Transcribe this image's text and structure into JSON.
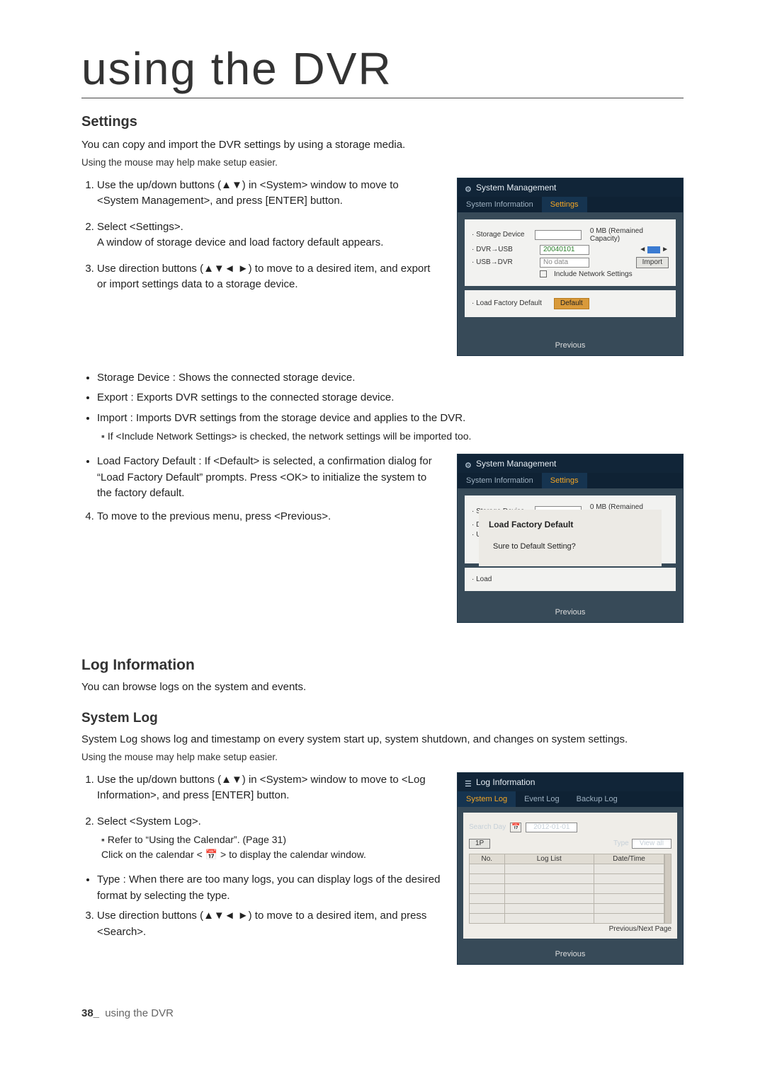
{
  "page": {
    "chapter_title": "using the DVR",
    "footer_num": "38_",
    "footer_text": "using the DVR"
  },
  "settings": {
    "heading": "Settings",
    "intro": "You can copy and import the DVR settings by using a storage media.",
    "mouse_hint": "Using the mouse may help make setup easier.",
    "steps": {
      "s1": "Use the up/down buttons (▲▼) in <System> window to move to <System Management>, and press [ENTER] button.",
      "s2a": "Select <Settings>.",
      "s2b": "A window of storage device and load factory default appears.",
      "s3": "Use direction buttons (▲▼◄ ►) to move to a desired item, and export or import settings data to a storage device."
    },
    "bullets": {
      "b1": "Storage Device : Shows the connected storage device.",
      "b2": "Export : Exports DVR settings to the connected storage device.",
      "b3": "Import : Imports DVR settings from the storage device and applies to the DVR.",
      "b3a": "If <Include Network Settings> is checked, the network settings will be imported too.",
      "b4": "Load Factory Default : If <Default> is selected, a confirmation dialog for “Load Factory Default” prompts. Press <OK> to initialize the system to the factory default."
    },
    "step4": "To move to the previous menu, press <Previous>."
  },
  "dvr1": {
    "title": "System Management",
    "tabs": {
      "info": "System Information",
      "settings": "Settings"
    },
    "storage_label": "· Storage Device",
    "capacity_text": "0 MB (Remained Capacity)",
    "dvr_usb_label": "· DVR→USB",
    "dvr_usb_value": "20040101",
    "usb_dvr_label": "· USB→DVR",
    "usb_dvr_value": "No data",
    "import_btn": "Import",
    "include_net": "Include Network Settings",
    "lfd_label": "· Load Factory Default",
    "default_btn": "Default",
    "previous": "Previous"
  },
  "dvr2": {
    "title": "System Management",
    "tabs": {
      "info": "System Information",
      "settings": "Settings"
    },
    "storage_label": "· Storage Device",
    "capacity_text": "0 MB (Remained Capacity)",
    "dvr_stub": "· DVR",
    "usb_stub": "· USB",
    "load_stub": "· Load",
    "modal_title": "Load Factory Default",
    "modal_msg": "Sure to Default Setting?",
    "previous": "Previous"
  },
  "loginfo": {
    "heading": "Log Information",
    "intro": "You can browse logs on the system and events."
  },
  "syslog": {
    "heading": "System Log",
    "intro": "System Log shows log and timestamp on every system start up, system shutdown, and changes on system settings.",
    "mouse_hint": "Using the mouse may help make setup easier.",
    "steps": {
      "s1": "Use the up/down buttons (▲▼) in <System> window to move to <Log Information>, and press [ENTER] button.",
      "s2a": "Select <System Log>.",
      "s2b": "Refer to “Using the Calendar”. (Page 31)",
      "s2c": "Click on the calendar < 📅 > to display the calendar window."
    },
    "bullets": {
      "b1": "Type : When there are too many logs, you can display logs of the desired format by selecting the type."
    },
    "step3": "Use direction buttons (▲▼◄ ►) to move to a desired item, and press <Search>."
  },
  "dvr3": {
    "title": "Log Information",
    "tabs": {
      "system": "System Log",
      "event": "Event Log",
      "backup": "Backup Log"
    },
    "search_day": "Search Day",
    "date_value": "2012-01-01",
    "page_ind": "1P",
    "type_label": "Type",
    "type_value": "View all",
    "col_no": "No.",
    "col_list": "Log List",
    "col_date": "Date/Time",
    "nav": "Previous/Next Page",
    "previous": "Previous"
  }
}
